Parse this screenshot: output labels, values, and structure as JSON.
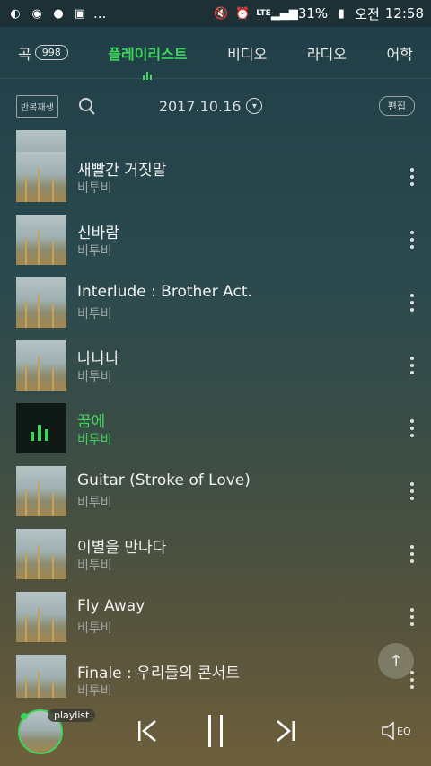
{
  "status": {
    "battery": "31%",
    "ampm": "오전",
    "time": "12:58",
    "network": "LTE",
    "more_indicator": "...",
    "icons": [
      "weather-icon",
      "melon-icon",
      "talk-icon",
      "gallery-icon",
      "mute-icon",
      "alarm-icon",
      "signal-icon",
      "battery-icon"
    ]
  },
  "tabs": [
    {
      "label": "곡",
      "count": "998",
      "active": false
    },
    {
      "label": "플레이리스트",
      "active": true
    },
    {
      "label": "비디오",
      "active": false
    },
    {
      "label": "라디오",
      "active": false
    },
    {
      "label": "어학",
      "active": false
    }
  ],
  "toolbar": {
    "repeat_label": "반복재생",
    "date": "2017.10.16",
    "edit_label": "편집"
  },
  "tracks": [
    {
      "title": "새빨간 거짓말",
      "artist": "비투비"
    },
    {
      "title": "신바람",
      "artist": "비투비"
    },
    {
      "title": "Interlude : Brother Act.",
      "artist": "비투비"
    },
    {
      "title": "나나나",
      "artist": "비투비"
    },
    {
      "title": "꿈에",
      "artist": "비투비",
      "playing": true
    },
    {
      "title": "Guitar (Stroke of Love)",
      "artist": "비투비"
    },
    {
      "title": "이별을 만나다",
      "artist": "비투비"
    },
    {
      "title": "Fly Away",
      "artist": "비투비"
    },
    {
      "title": "Finale : 우리들의 콘서트",
      "artist": "비투비"
    }
  ],
  "player": {
    "playlist_label": "playlist",
    "eq_label": "EQ"
  },
  "colors": {
    "accent": "#3fd45d"
  }
}
